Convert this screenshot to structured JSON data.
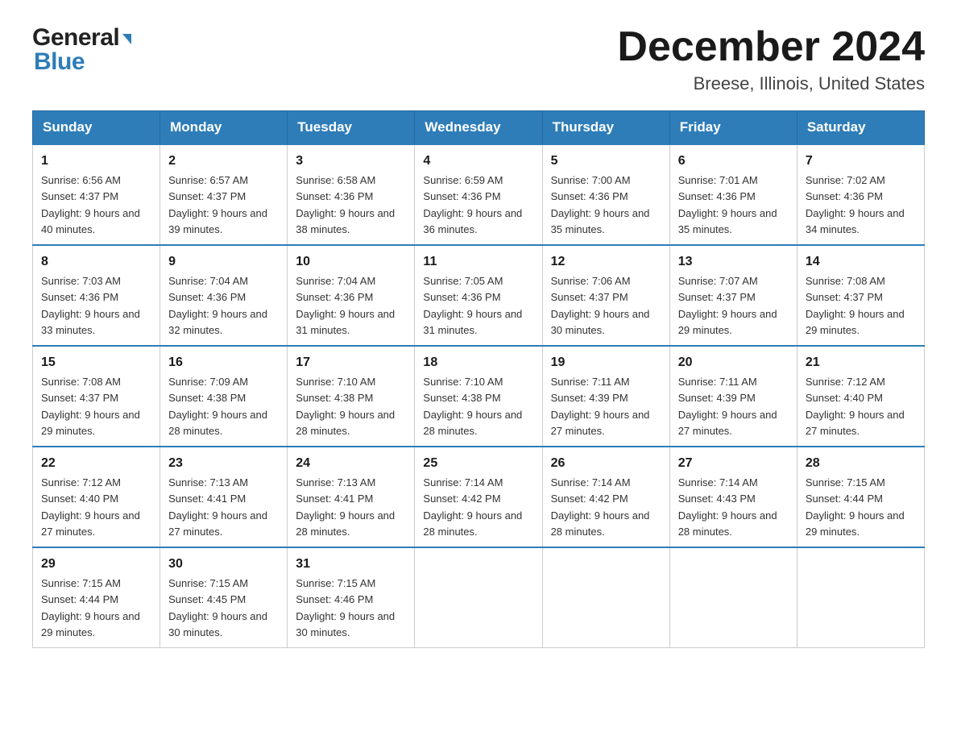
{
  "header": {
    "logo_general": "General",
    "logo_blue": "Blue",
    "month_title": "December 2024",
    "location": "Breese, Illinois, United States"
  },
  "weekdays": [
    "Sunday",
    "Monday",
    "Tuesday",
    "Wednesday",
    "Thursday",
    "Friday",
    "Saturday"
  ],
  "rows": [
    [
      {
        "day": "1",
        "sunrise": "6:56 AM",
        "sunset": "4:37 PM",
        "daylight": "9 hours and 40 minutes."
      },
      {
        "day": "2",
        "sunrise": "6:57 AM",
        "sunset": "4:37 PM",
        "daylight": "9 hours and 39 minutes."
      },
      {
        "day": "3",
        "sunrise": "6:58 AM",
        "sunset": "4:36 PM",
        "daylight": "9 hours and 38 minutes."
      },
      {
        "day": "4",
        "sunrise": "6:59 AM",
        "sunset": "4:36 PM",
        "daylight": "9 hours and 36 minutes."
      },
      {
        "day": "5",
        "sunrise": "7:00 AM",
        "sunset": "4:36 PM",
        "daylight": "9 hours and 35 minutes."
      },
      {
        "day": "6",
        "sunrise": "7:01 AM",
        "sunset": "4:36 PM",
        "daylight": "9 hours and 35 minutes."
      },
      {
        "day": "7",
        "sunrise": "7:02 AM",
        "sunset": "4:36 PM",
        "daylight": "9 hours and 34 minutes."
      }
    ],
    [
      {
        "day": "8",
        "sunrise": "7:03 AM",
        "sunset": "4:36 PM",
        "daylight": "9 hours and 33 minutes."
      },
      {
        "day": "9",
        "sunrise": "7:04 AM",
        "sunset": "4:36 PM",
        "daylight": "9 hours and 32 minutes."
      },
      {
        "day": "10",
        "sunrise": "7:04 AM",
        "sunset": "4:36 PM",
        "daylight": "9 hours and 31 minutes."
      },
      {
        "day": "11",
        "sunrise": "7:05 AM",
        "sunset": "4:36 PM",
        "daylight": "9 hours and 31 minutes."
      },
      {
        "day": "12",
        "sunrise": "7:06 AM",
        "sunset": "4:37 PM",
        "daylight": "9 hours and 30 minutes."
      },
      {
        "day": "13",
        "sunrise": "7:07 AM",
        "sunset": "4:37 PM",
        "daylight": "9 hours and 29 minutes."
      },
      {
        "day": "14",
        "sunrise": "7:08 AM",
        "sunset": "4:37 PM",
        "daylight": "9 hours and 29 minutes."
      }
    ],
    [
      {
        "day": "15",
        "sunrise": "7:08 AM",
        "sunset": "4:37 PM",
        "daylight": "9 hours and 29 minutes."
      },
      {
        "day": "16",
        "sunrise": "7:09 AM",
        "sunset": "4:38 PM",
        "daylight": "9 hours and 28 minutes."
      },
      {
        "day": "17",
        "sunrise": "7:10 AM",
        "sunset": "4:38 PM",
        "daylight": "9 hours and 28 minutes."
      },
      {
        "day": "18",
        "sunrise": "7:10 AM",
        "sunset": "4:38 PM",
        "daylight": "9 hours and 28 minutes."
      },
      {
        "day": "19",
        "sunrise": "7:11 AM",
        "sunset": "4:39 PM",
        "daylight": "9 hours and 27 minutes."
      },
      {
        "day": "20",
        "sunrise": "7:11 AM",
        "sunset": "4:39 PM",
        "daylight": "9 hours and 27 minutes."
      },
      {
        "day": "21",
        "sunrise": "7:12 AM",
        "sunset": "4:40 PM",
        "daylight": "9 hours and 27 minutes."
      }
    ],
    [
      {
        "day": "22",
        "sunrise": "7:12 AM",
        "sunset": "4:40 PM",
        "daylight": "9 hours and 27 minutes."
      },
      {
        "day": "23",
        "sunrise": "7:13 AM",
        "sunset": "4:41 PM",
        "daylight": "9 hours and 27 minutes."
      },
      {
        "day": "24",
        "sunrise": "7:13 AM",
        "sunset": "4:41 PM",
        "daylight": "9 hours and 28 minutes."
      },
      {
        "day": "25",
        "sunrise": "7:14 AM",
        "sunset": "4:42 PM",
        "daylight": "9 hours and 28 minutes."
      },
      {
        "day": "26",
        "sunrise": "7:14 AM",
        "sunset": "4:42 PM",
        "daylight": "9 hours and 28 minutes."
      },
      {
        "day": "27",
        "sunrise": "7:14 AM",
        "sunset": "4:43 PM",
        "daylight": "9 hours and 28 minutes."
      },
      {
        "day": "28",
        "sunrise": "7:15 AM",
        "sunset": "4:44 PM",
        "daylight": "9 hours and 29 minutes."
      }
    ],
    [
      {
        "day": "29",
        "sunrise": "7:15 AM",
        "sunset": "4:44 PM",
        "daylight": "9 hours and 29 minutes."
      },
      {
        "day": "30",
        "sunrise": "7:15 AM",
        "sunset": "4:45 PM",
        "daylight": "9 hours and 30 minutes."
      },
      {
        "day": "31",
        "sunrise": "7:15 AM",
        "sunset": "4:46 PM",
        "daylight": "9 hours and 30 minutes."
      },
      null,
      null,
      null,
      null
    ]
  ]
}
